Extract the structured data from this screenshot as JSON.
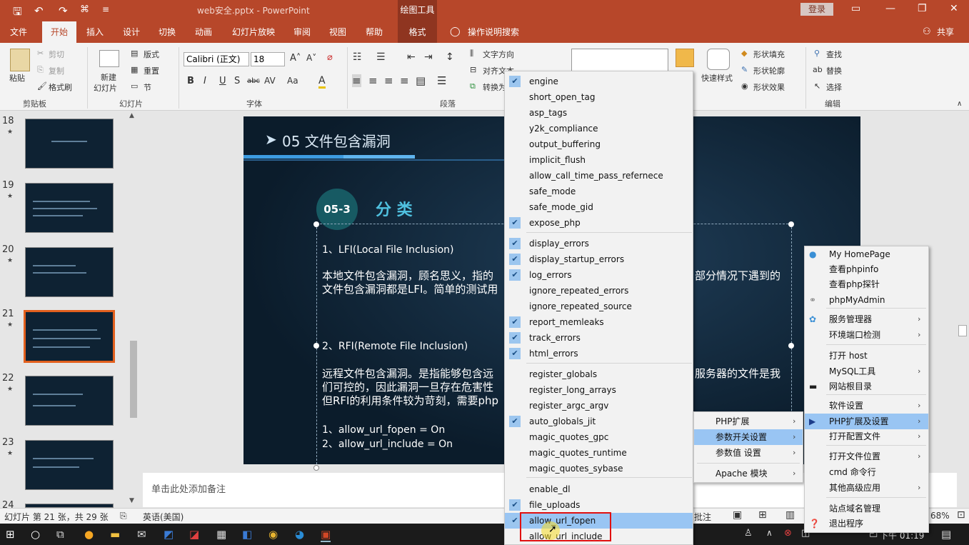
{
  "window": {
    "doc_title": "web安全.pptx - PowerPoint",
    "drawing_tools": "绘图工具",
    "login": "登录"
  },
  "qat": {
    "save": "🖫",
    "undo": "↶",
    "redo": "↷",
    "more": "≡"
  },
  "tabs": [
    "文件",
    "开始",
    "插入",
    "设计",
    "切换",
    "动画",
    "幻灯片放映",
    "审阅",
    "视图",
    "帮助",
    "格式"
  ],
  "tell_me": "操作说明搜索",
  "share": "共享",
  "ribbon": {
    "paste": "粘贴",
    "cut": "剪切",
    "copy": "复制",
    "format_painter": "格式刷",
    "clipboard": "剪贴板",
    "new_slide": "新建",
    "new_slide2": "幻灯片",
    "layout": "版式",
    "reset": "重置",
    "section": "节",
    "slides_group": "幻灯片",
    "font_name": "Calibri (正文)",
    "font_size": "18",
    "font_group": "字体",
    "paragraph_group": "段落",
    "text_direction": "文字方向",
    "align_text": "对齐文本",
    "convert": "转换为",
    "quick_styles": "快速样式",
    "shape_fill": "形状填充",
    "shape_outline": "形状轮廓",
    "shape_effects": "形状效果",
    "find": "查找",
    "replace": "替换",
    "select": "选择",
    "editing_group": "编辑"
  },
  "slide_numbers": [
    "18",
    "19",
    "20",
    "21",
    "22",
    "23",
    "24"
  ],
  "slide": {
    "header": "05 文件包含漏洞",
    "badge": "05-3",
    "title": "分 类",
    "lfi_title": "1、LFI(Local File Inclusion)",
    "lfi_body1": "本地文件包含漏洞，顾名思义，指的",
    "lfi_body1b": "部分情况下遇到的",
    "lfi_body2": "文件包含漏洞都是LFI。简单的测试用",
    "rfi_title": "2、RFI(Remote File Inclusion)",
    "rfi_body1": "远程文件包含漏洞。是指能够包含远",
    "rfi_body1b": "服务器的文件是我",
    "rfi_body2": "们可控的，因此漏洞一旦存在危害性",
    "rfi_body3": "但RFI的利用条件较为苛刻，需要php",
    "cond1": "1、allow_url_fopen = On",
    "cond2": "2、allow_url_include = On"
  },
  "notes_placeholder": "单击此处添加备注",
  "status": {
    "slide_info": "幻灯片 第 21 张，共 29 张",
    "language": "英语(美国)",
    "comments": "批注",
    "zoom": "68%"
  },
  "taskbar_time": "下午 01:19",
  "settings_menu": [
    {
      "label": "engine",
      "checked": true
    },
    {
      "label": "short_open_tag",
      "checked": false
    },
    {
      "label": "asp_tags",
      "checked": false
    },
    {
      "label": "y2k_compliance",
      "checked": false
    },
    {
      "label": "output_buffering",
      "checked": false
    },
    {
      "label": "implicit_flush",
      "checked": false
    },
    {
      "label": "allow_call_time_pass_refernece",
      "checked": false
    },
    {
      "label": "safe_mode",
      "checked": false
    },
    {
      "label": "safe_mode_gid",
      "checked": false
    },
    {
      "label": "expose_php",
      "checked": true
    },
    {
      "label": "display_errors",
      "checked": true
    },
    {
      "label": "display_startup_errors",
      "checked": true
    },
    {
      "label": "log_errors",
      "checked": true
    },
    {
      "label": "ignore_repeated_errors",
      "checked": false
    },
    {
      "label": "ignore_repeated_source",
      "checked": false
    },
    {
      "label": "report_memleaks",
      "checked": true
    },
    {
      "label": "track_errors",
      "checked": true
    },
    {
      "label": "html_errors",
      "checked": true
    },
    {
      "label": "register_globals",
      "checked": false
    },
    {
      "label": "register_long_arrays",
      "checked": false
    },
    {
      "label": "register_argc_argv",
      "checked": false
    },
    {
      "label": "auto_globals_jit",
      "checked": true
    },
    {
      "label": "magic_quotes_gpc",
      "checked": false
    },
    {
      "label": "magic_quotes_runtime",
      "checked": false
    },
    {
      "label": "magic_quotes_sybase",
      "checked": false
    },
    {
      "label": "enable_dl",
      "checked": false
    },
    {
      "label": "file_uploads",
      "checked": true
    },
    {
      "label": "allow_url_fopen",
      "checked": true
    },
    {
      "label": "allow_url_include",
      "checked": false
    }
  ],
  "php_ext_menu": [
    "PHP扩展",
    "参数开关设置",
    "参数值 设置",
    "Apache 模块"
  ],
  "tray_menu": [
    "My HomePage",
    "查看phpinfo",
    "查看php探针",
    "phpMyAdmin",
    "服务管理器",
    "环境端口检测",
    "打开 host",
    "MySQL工具",
    "网站根目录",
    "软件设置",
    "PHP扩展及设置",
    "打开配置文件",
    "打开文件位置",
    "cmd 命令行",
    "其他高级应用",
    "站点域名管理",
    "退出程序"
  ]
}
